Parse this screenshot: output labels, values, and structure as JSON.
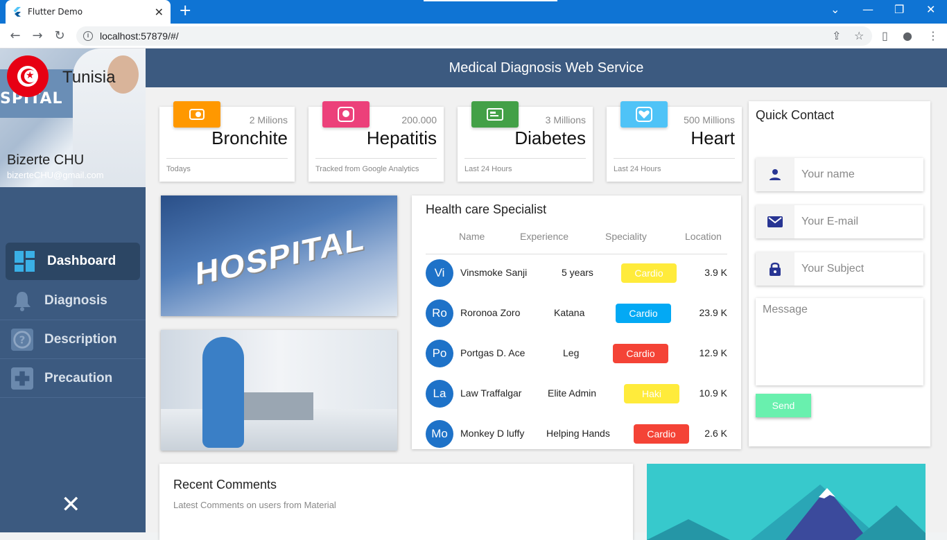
{
  "browser": {
    "tab_title": "Flutter Demo",
    "url": "localhost:57879/#/"
  },
  "sidebar": {
    "country": "Tunisia",
    "hospital_name": "Bizerte CHU",
    "hospital_email": "bizerteCHU@gmail.com",
    "items": [
      {
        "label": "Dashboard",
        "icon": "dashboard-icon"
      },
      {
        "label": "Diagnosis",
        "icon": "bell-icon"
      },
      {
        "label": "Description",
        "icon": "help-icon"
      },
      {
        "label": "Precaution",
        "icon": "plus-icon"
      }
    ]
  },
  "header": {
    "title": "Medical Diagnosis Web Service"
  },
  "stats": [
    {
      "count": "2 Milions",
      "name": "Bronchite",
      "sub": "Todays",
      "color": "#ff9800"
    },
    {
      "count": "200.000",
      "name": "Hepatitis",
      "sub": "Tracked from Google Analytics",
      "color": "#ec407a"
    },
    {
      "count": "3 Millions",
      "name": "Diabetes",
      "sub": "Last 24 Hours",
      "color": "#43a047"
    },
    {
      "count": "500 Millions",
      "name": "Heart",
      "sub": "Last 24 Hours",
      "color": "#4fc3f7"
    }
  ],
  "photos": {
    "hospital_sign": "HOSPITAL"
  },
  "specialists": {
    "title": "Health care Specialist",
    "columns": [
      "Name",
      "Experience",
      "Speciality",
      "Location"
    ],
    "rows": [
      {
        "initials": "Vi",
        "name": "Vinsmoke Sanji",
        "experience": "5 years",
        "speciality": "Cardio",
        "badge_color": "#ffeb3b",
        "location": "3.9 K"
      },
      {
        "initials": "Ro",
        "name": "Roronoa Zoro",
        "experience": "Katana",
        "speciality": "Cardio",
        "badge_color": "#03a9f4",
        "location": "23.9 K"
      },
      {
        "initials": "Po",
        "name": "Portgas D. Ace",
        "experience": "Leg",
        "speciality": "Cardio",
        "badge_color": "#f44336",
        "location": "12.9 K"
      },
      {
        "initials": "La",
        "name": "Law Traffalgar",
        "experience": "Elite Admin",
        "speciality": "Haki",
        "badge_color": "#ffeb3b",
        "location": "10.9 K"
      },
      {
        "initials": "Mo",
        "name": "Monkey D luffy",
        "experience": "Helping Hands",
        "speciality": "Cardio",
        "badge_color": "#f44336",
        "location": "2.6 K"
      }
    ]
  },
  "contact": {
    "title": "Quick Contact",
    "name_placeholder": "Your name",
    "email_placeholder": "Your E-mail",
    "subject_placeholder": "Your Subject",
    "message_placeholder": "Message",
    "send_label": "Send"
  },
  "comments": {
    "title": "Recent Comments",
    "subtitle": "Latest Comments on users from Material"
  }
}
